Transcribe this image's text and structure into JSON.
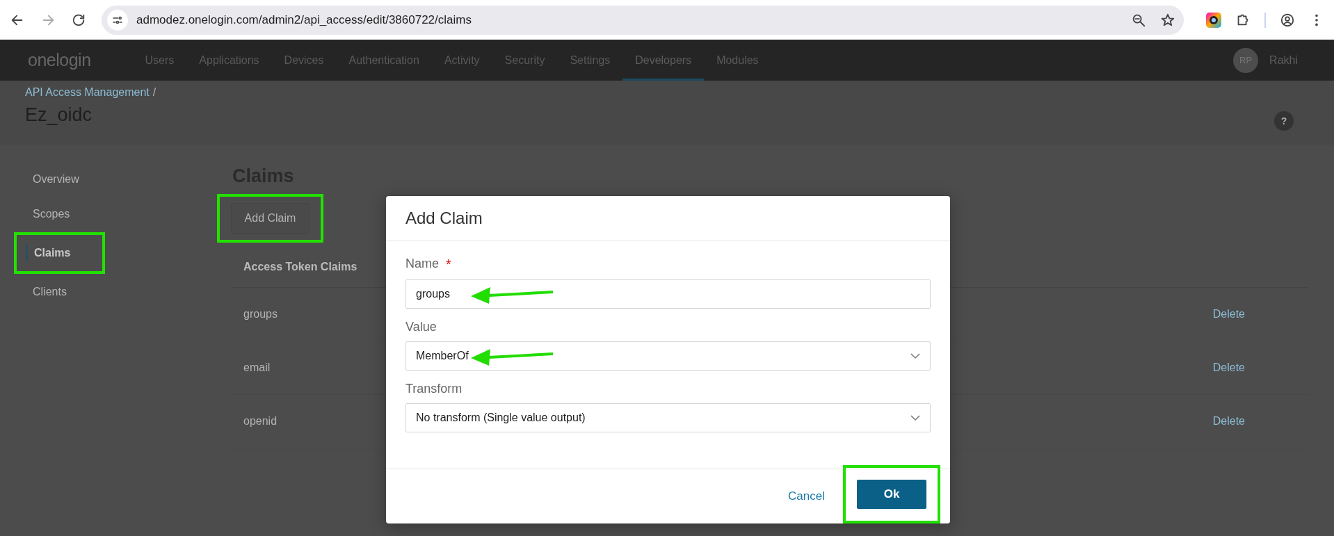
{
  "browser": {
    "url": "admodez.onelogin.com/admin2/api_access/edit/3860722/claims"
  },
  "nav": {
    "logo": "onelogin",
    "items": [
      {
        "label": "Users",
        "selected": false
      },
      {
        "label": "Applications",
        "selected": false
      },
      {
        "label": "Devices",
        "selected": false
      },
      {
        "label": "Authentication",
        "selected": false
      },
      {
        "label": "Activity",
        "selected": false
      },
      {
        "label": "Security",
        "selected": false
      },
      {
        "label": "Settings",
        "selected": false
      },
      {
        "label": "Developers",
        "selected": true
      },
      {
        "label": "Modules",
        "selected": false
      }
    ],
    "user": {
      "initials": "RP",
      "name": "Rakhi"
    }
  },
  "header": {
    "breadcrumb": "API Access Management",
    "separator": "/",
    "title": "Ez_oidc",
    "help": "?"
  },
  "sidebar": {
    "items": [
      {
        "label": "Overview",
        "selected": false,
        "highlighted": false
      },
      {
        "label": "Scopes",
        "selected": false,
        "highlighted": false
      },
      {
        "label": "Claims",
        "selected": true,
        "highlighted": true
      },
      {
        "label": "Clients",
        "selected": false,
        "highlighted": false
      }
    ]
  },
  "content": {
    "heading": "Claims",
    "add_button": {
      "label": "Add Claim",
      "highlighted": true
    },
    "table": {
      "header": "Access Token Claims",
      "rows": [
        {
          "name": "groups",
          "action": "Delete"
        },
        {
          "name": "email",
          "action": "Delete"
        },
        {
          "name": "openid",
          "action": "Delete"
        }
      ]
    }
  },
  "dialog": {
    "title": "Add Claim",
    "fields": [
      {
        "kind": "input",
        "label": "Name",
        "required_mark": "*",
        "value": "groups",
        "arrow": true
      },
      {
        "kind": "select",
        "label": "Value",
        "value": "MemberOf",
        "arrow": true
      },
      {
        "kind": "select",
        "label": "Transform",
        "value": "No transform (Single value output)",
        "arrow": false
      }
    ],
    "cancel": "Cancel",
    "ok": {
      "label": "Ok",
      "highlighted": true
    }
  }
}
